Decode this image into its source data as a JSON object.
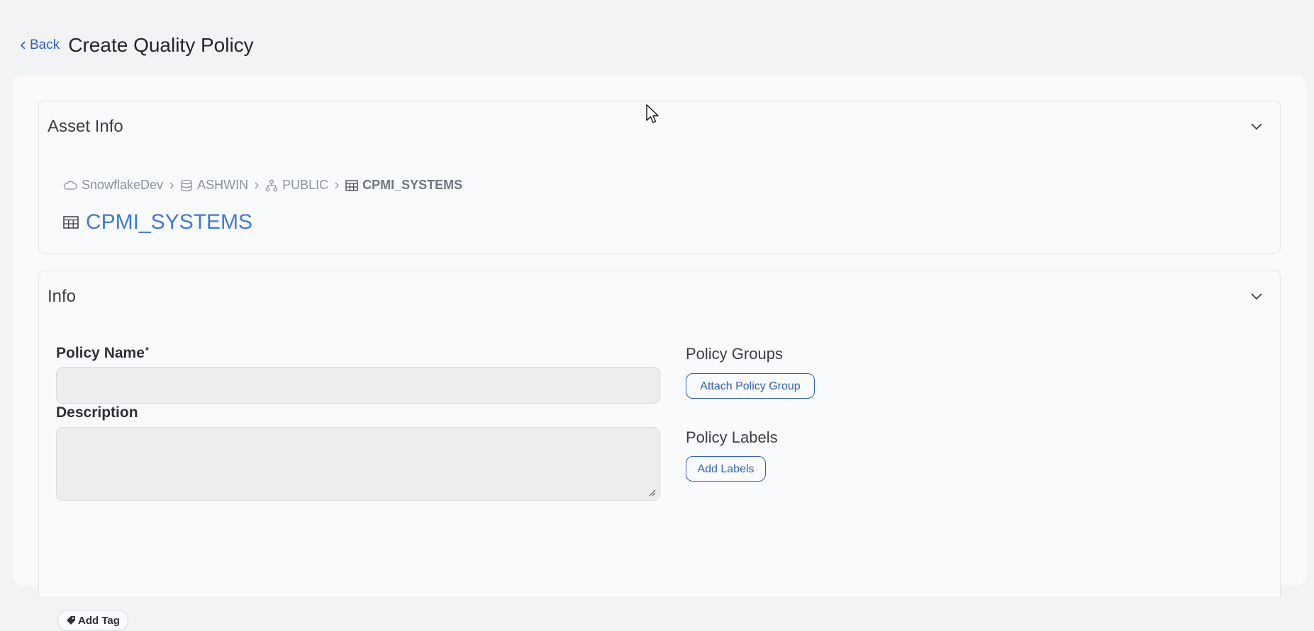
{
  "header": {
    "back_label": "Back",
    "title": "Create Quality Policy"
  },
  "asset_info": {
    "title": "Asset Info",
    "breadcrumb": [
      {
        "label": "SnowflakeDev",
        "icon": "cloud-icon"
      },
      {
        "label": "ASHWIN",
        "icon": "database-icon"
      },
      {
        "label": "PUBLIC",
        "icon": "schema-icon"
      },
      {
        "label": "CPMI_SYSTEMS",
        "icon": "table-icon"
      }
    ],
    "asset_name": "CPMI_SYSTEMS"
  },
  "info": {
    "title": "Info",
    "policy_name_label": "Policy Name",
    "required_mark": "*",
    "policy_name_value": "",
    "description_label": "Description",
    "description_value": "",
    "policy_groups_label": "Policy Groups",
    "attach_policy_group_label": "Attach Policy Group",
    "policy_labels_label": "Policy Labels",
    "add_labels_label": "Add Labels",
    "add_tag_label": "Add Tag"
  },
  "colors": {
    "accent": "#2f62b6",
    "asset_link": "#3f7ad6",
    "background": "#f2f3f5"
  }
}
